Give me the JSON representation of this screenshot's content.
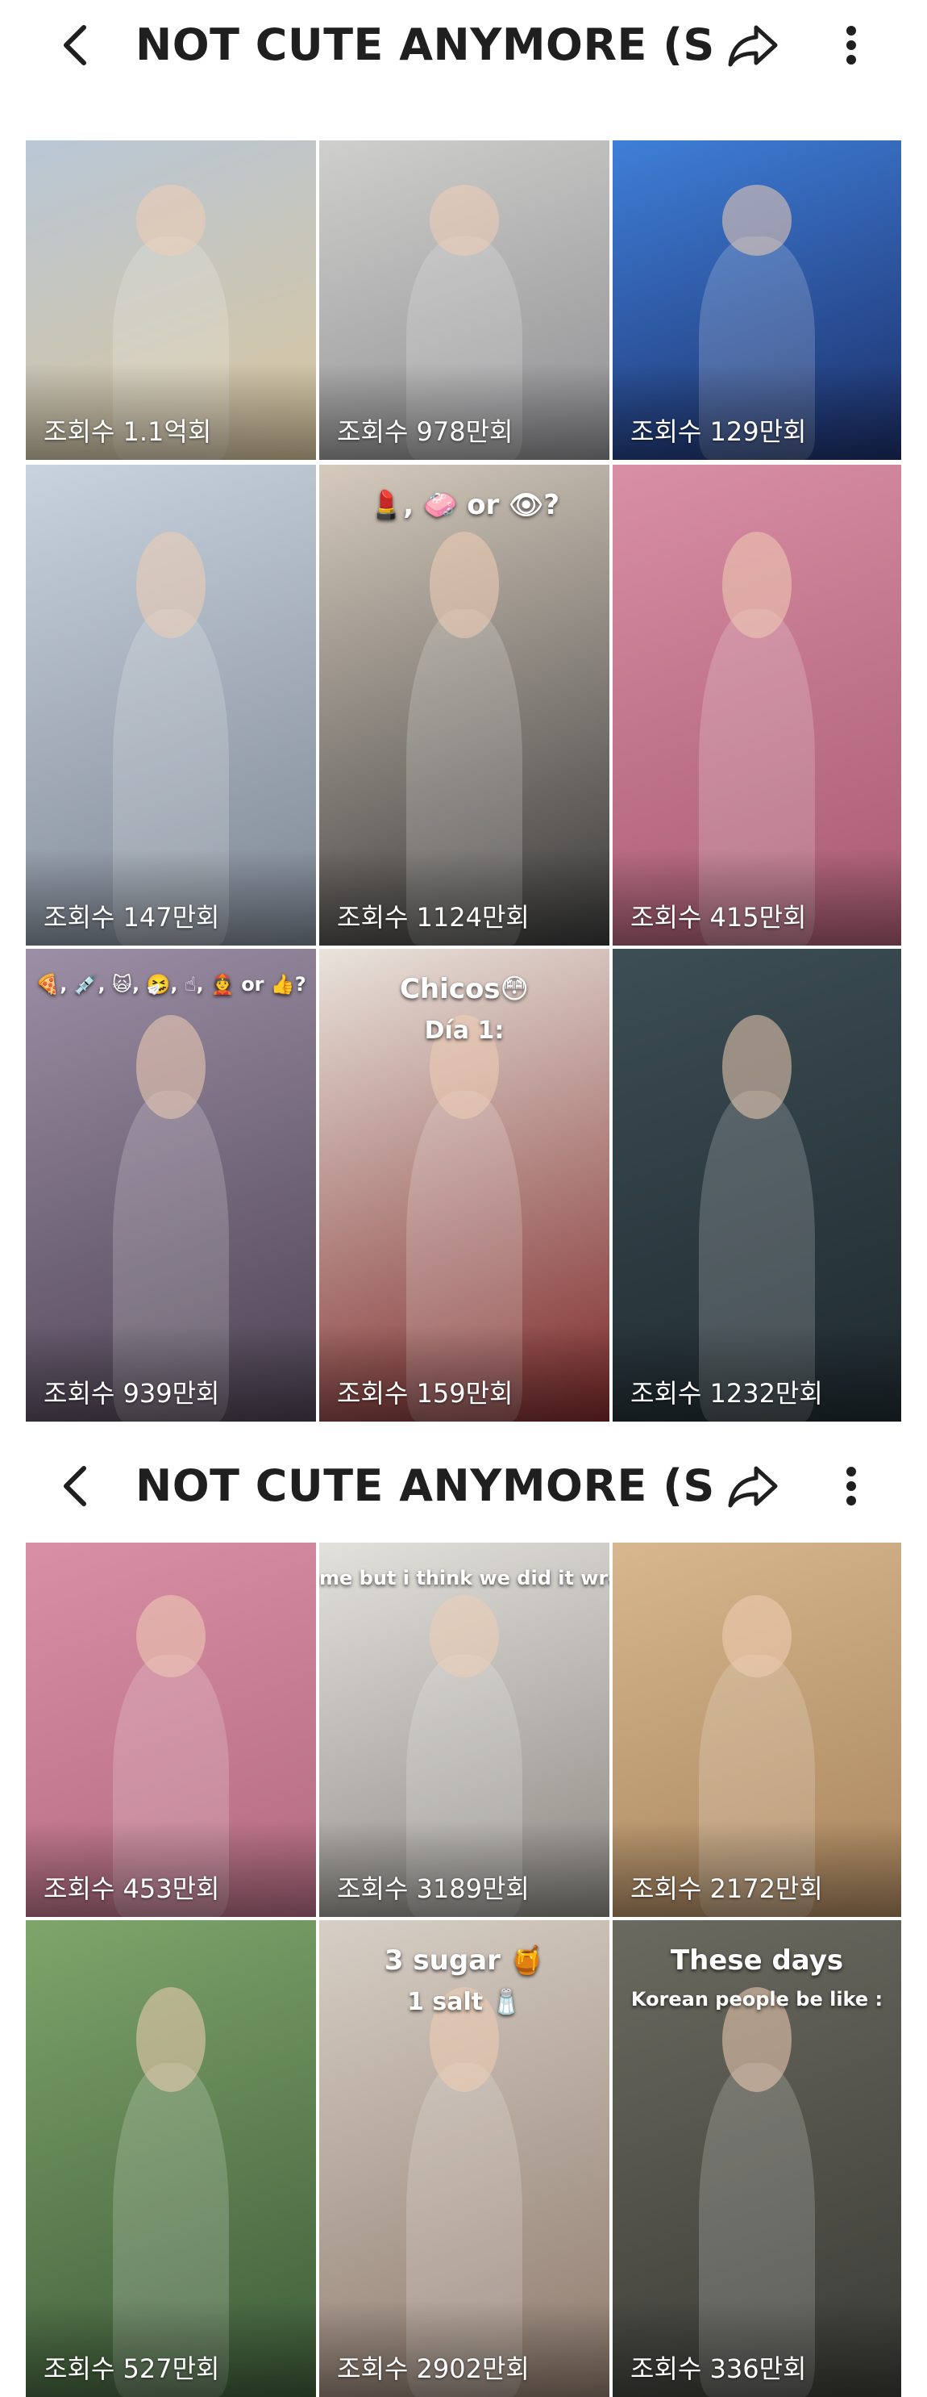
{
  "sections": [
    {
      "title": "NOT CUTE ANYMORE (S...",
      "tiles": [
        {
          "views": "조회수 1.1억회",
          "colors": [
            "#b9c7d6",
            "#d8c59c"
          ]
        },
        {
          "views": "조회수 978만회",
          "colors": [
            "#cfcfcd",
            "#8f8f92"
          ]
        },
        {
          "views": "조회수 129만회",
          "colors": [
            "#3f7fd8",
            "#1c2f6a"
          ]
        },
        {
          "views": "조회수 147만회",
          "colors": [
            "#c9d3de",
            "#7e8794"
          ]
        },
        {
          "views": "조회수 1124만회",
          "colors": [
            "#d6cbbd",
            "#3a3a3a"
          ],
          "caption": "💄, 🧼 or 👁?"
        },
        {
          "views": "조회수 415만회",
          "colors": [
            "#d98fa5",
            "#a85a72"
          ]
        },
        {
          "views": "조회수 939만회",
          "colors": [
            "#9c8fa6",
            "#4d4252"
          ],
          "caption": "🍕, 💉, 🙀, 🤧, ☝, 👲 or 👍?"
        },
        {
          "views": "조회수 159만회",
          "colors": [
            "#e9e4dc",
            "#7d2a2a"
          ],
          "caption": "Chicos😳",
          "caption2": "Día 1:"
        },
        {
          "views": "조회수 1232만회",
          "colors": [
            "#3d4e55",
            "#1f2a30"
          ]
        }
      ]
    },
    {
      "title": "NOT CUTE ANYMORE (S...",
      "tiles": [
        {
          "views": "조회수 453만회",
          "colors": [
            "#d98fa5",
            "#b36b82"
          ]
        },
        {
          "views": "조회수 3189만회",
          "colors": [
            "#e3e1dc",
            "#8d8a84"
          ],
          "caption": "me but i think we did it wrong?"
        },
        {
          "views": "조회수 2172만회",
          "colors": [
            "#d7b78e",
            "#a9855d"
          ]
        },
        {
          "views": "조회수 527만회",
          "colors": [
            "#7fa56b",
            "#3e5d39"
          ]
        },
        {
          "views": "조회수 2902만회",
          "colors": [
            "#d7cfc6",
            "#8f7b6d"
          ],
          "caption": "3 sugar 🍯",
          "caption2": "1 salt 🧂"
        },
        {
          "views": "조회수 336만회",
          "colors": [
            "#6a6a60",
            "#3b3b36"
          ],
          "caption": "These days",
          "caption2": "Korean people be like :"
        }
      ]
    }
  ],
  "icons": {
    "back": "back-arrow-icon",
    "share": "share-icon",
    "more": "more-vertical-icon"
  }
}
